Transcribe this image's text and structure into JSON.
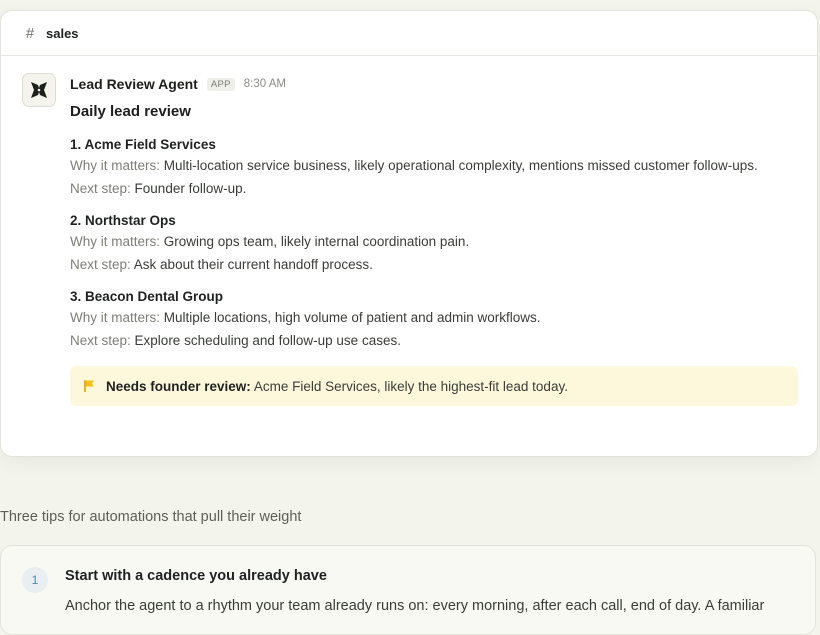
{
  "channel": {
    "icon": "hash-icon",
    "name": "sales"
  },
  "message": {
    "sender": "Lead Review Agent",
    "badge": "APP",
    "time": "8:30 AM",
    "title": "Daily lead review",
    "leads": [
      {
        "name": "1. Acme Field Services",
        "why_label": "Why it matters:",
        "why": "Multi-location service business, likely operational complexity, mentions missed customer follow-ups.",
        "next_label": "Next step:",
        "next": "Founder follow-up."
      },
      {
        "name": "2. Northstar Ops",
        "why_label": "Why it matters:",
        "why": "Growing ops team, likely internal coordination pain.",
        "next_label": "Next step:",
        "next": "Ask about their current handoff process."
      },
      {
        "name": "3. Beacon Dental Group",
        "why_label": "Why it matters:",
        "why": "Multiple locations, high volume of patient and admin workflows.",
        "next_label": "Next step:",
        "next": "Explore scheduling and follow-up use cases."
      }
    ],
    "callout": {
      "icon": "flag-icon",
      "label": "Needs founder review:",
      "text": "Acme Field Services, likely the highest-fit lead today.",
      "color": "#f2c21b"
    }
  },
  "tips": {
    "heading": "Three tips for automations that pull their weight",
    "items": [
      {
        "number": "1",
        "title": "Start with a cadence you already have",
        "body": "Anchor the agent to a rhythm your team already runs on: every morning, after each call, end of day. A familiar"
      }
    ]
  }
}
